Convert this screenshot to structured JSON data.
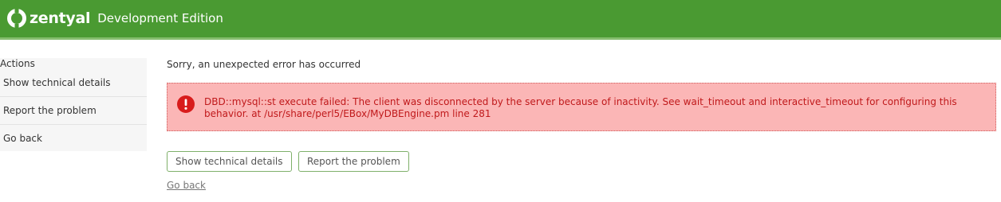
{
  "header": {
    "brand": "zentyal",
    "edition": "Development Edition",
    "bar_color": "#4a9a32",
    "logo_icon": "zentyal-logo-icon"
  },
  "sidebar": {
    "title": "Actions",
    "items": [
      {
        "label": "Show technical details"
      },
      {
        "label": "Report the problem"
      },
      {
        "label": "Go back"
      }
    ]
  },
  "main": {
    "heading": "Sorry, an unexpected error has occurred",
    "error": {
      "icon": "error-exclamation-icon",
      "message": "DBD::mysql::st execute failed: The client was disconnected by the server because of inactivity. See wait_timeout and interactive_timeout for configuring this behavior. at /usr/share/perl5/EBox/MyDBEngine.pm line 281",
      "background_color": "#fbb6b6",
      "text_color": "#c0191b"
    },
    "buttons": {
      "show_details": "Show technical details",
      "report_problem": "Report the problem"
    },
    "go_back_link": "Go back"
  }
}
